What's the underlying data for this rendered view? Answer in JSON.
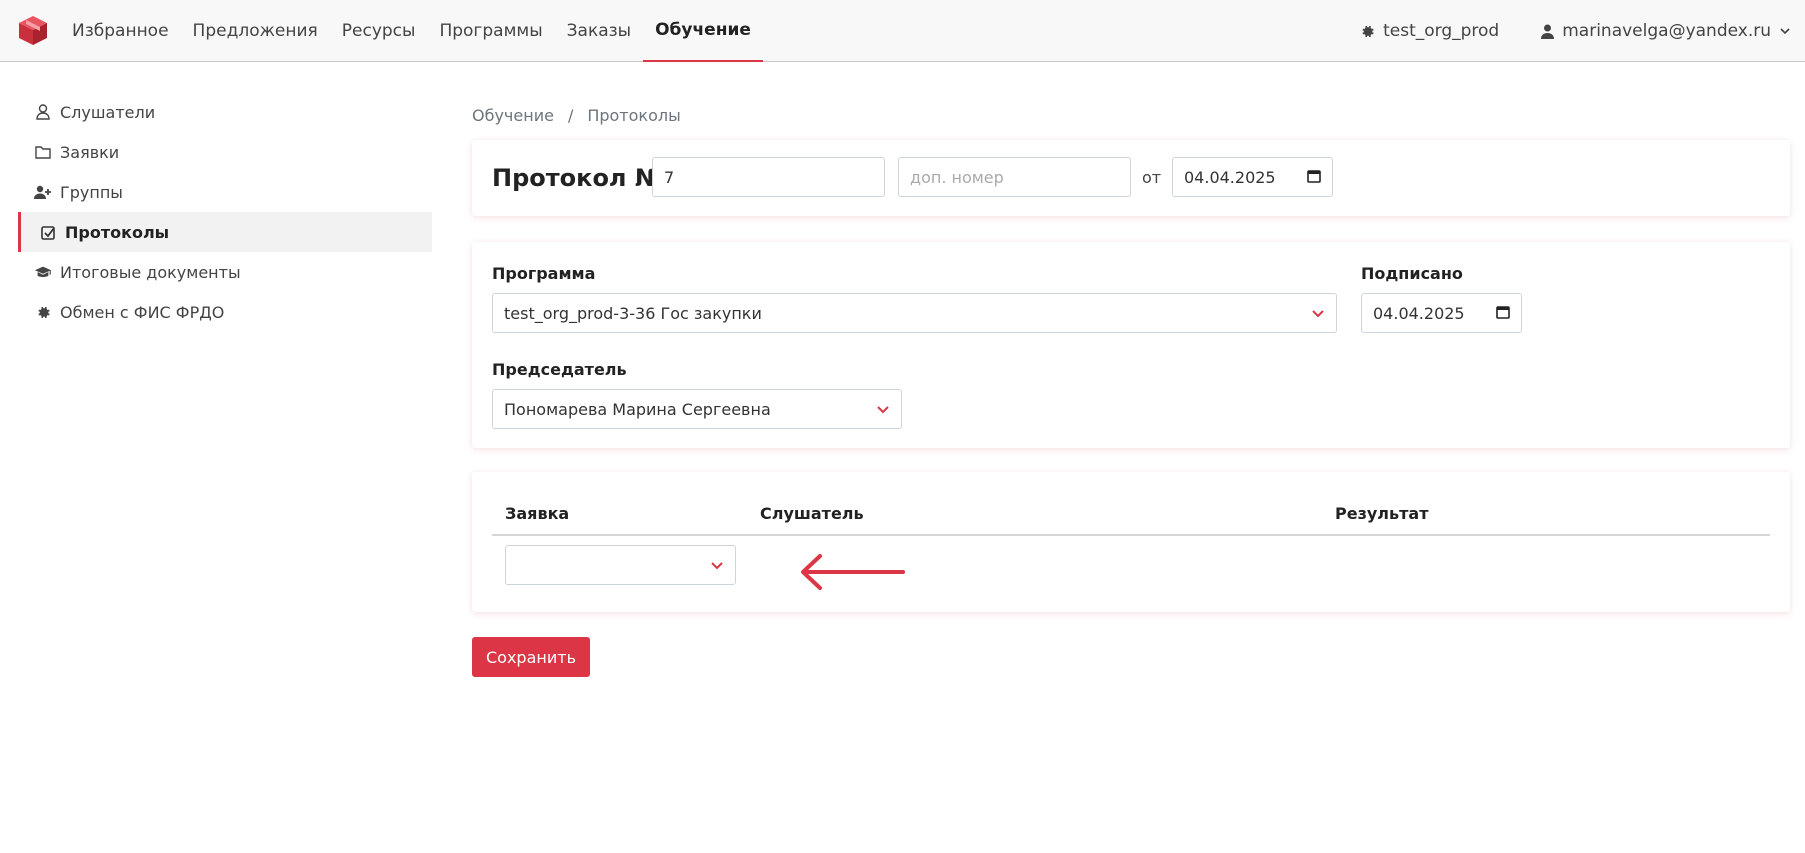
{
  "nav": {
    "items": [
      {
        "label": "Избранное"
      },
      {
        "label": "Предложения"
      },
      {
        "label": "Ресурсы"
      },
      {
        "label": "Программы"
      },
      {
        "label": "Заказы"
      },
      {
        "label": "Обучение",
        "active": true
      }
    ],
    "org": "test_org_prod",
    "user": "marinavelga@yandex.ru"
  },
  "sidebar": {
    "items": [
      {
        "label": "Слушатели",
        "icon": "user-icon"
      },
      {
        "label": "Заявки",
        "icon": "folder-icon"
      },
      {
        "label": "Группы",
        "icon": "user-plus-icon"
      },
      {
        "label": "Протоколы",
        "icon": "check-square-icon",
        "active": true
      },
      {
        "label": "Итоговые документы",
        "icon": "graduation-cap-icon"
      },
      {
        "label": "Обмен с ФИС ФРДО",
        "icon": "gear-icon"
      }
    ]
  },
  "breadcrumb": {
    "parent": "Обучение",
    "separator": "/",
    "current": "Протоколы"
  },
  "protocol": {
    "title": "Протокол №",
    "number_value": "7",
    "extra_number_placeholder": "доп. номер",
    "from_label": "от",
    "date_value": "04.04.2025"
  },
  "details": {
    "program_label": "Программа",
    "program_value": "test_org_prod-3-36 Гос закупки",
    "signed_label": "Подписано",
    "signed_value": "04.04.2025",
    "chairman_label": "Председатель",
    "chairman_value": "Пономарева Марина Сергеевна"
  },
  "table": {
    "headers": {
      "application": "Заявка",
      "listener": "Слушатель",
      "result": "Результат"
    },
    "rows": [
      {
        "application": ""
      }
    ]
  },
  "actions": {
    "save_label": "Сохранить"
  },
  "colors": {
    "accent": "#dc3545"
  }
}
